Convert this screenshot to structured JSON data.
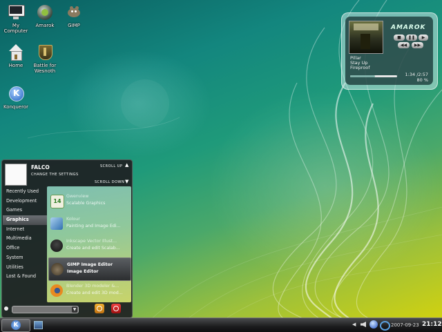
{
  "desktop": {
    "icons": [
      {
        "label": "My\nComputer",
        "icon": "monitor-icon"
      },
      {
        "label": "Amarok",
        "icon": "amarok-wolf-icon"
      },
      {
        "label": "GIMP",
        "icon": "gimp-icon"
      },
      {
        "label": "Home",
        "icon": "home-icon"
      },
      {
        "label": "Battle for\nWesnoth",
        "icon": "shield-icon"
      },
      {
        "label": "Konqueror",
        "icon": "kde-gear-icon"
      }
    ]
  },
  "amarok_widget": {
    "logo": "AMAROK",
    "artist": "Pillar",
    "title": "Stay Up",
    "album": "Fireproof",
    "time": "1:34 /2:57",
    "volume": "80  %",
    "progress": 0.53
  },
  "start_menu": {
    "username": "FALCO",
    "subtitle": "CHANGE THE SETTINGS",
    "scroll_up": "SCROLL UP",
    "scroll_down": "SCROLL DOWN",
    "categories": [
      "Recently Used",
      "Development",
      "Games",
      "Graphics",
      "Internet",
      "Multimedia",
      "Office",
      "System",
      "Utilities",
      "Lost & Found"
    ],
    "active_category": "Graphics",
    "apps": [
      {
        "name": "Gwenview",
        "desc": "Scalable Graphics",
        "icon": "image-viewer-icon"
      },
      {
        "name": "Kolour",
        "desc": "Painting and Image Edi...",
        "icon": "paint-icon"
      },
      {
        "name": "Inkscape Vector Illust...",
        "desc": "Create and edit Scalab...",
        "icon": "inkscape-icon"
      },
      {
        "name": "GIMP Image Editor",
        "desc": "Image Editor",
        "icon": "gimp-icon"
      },
      {
        "name": "Blender 3D modeler &...",
        "desc": "Create and edit 3D mod...",
        "icon": "blender-icon"
      }
    ],
    "selected_app": "GIMP Image Editor"
  },
  "taskbar": {
    "date": "2007-09-23",
    "clock": "21:12"
  },
  "colors": {
    "menu_bg": "#1e2022",
    "active_category": "#5a5e62",
    "logout": "#e8a020",
    "shutdown": "#d02020"
  }
}
